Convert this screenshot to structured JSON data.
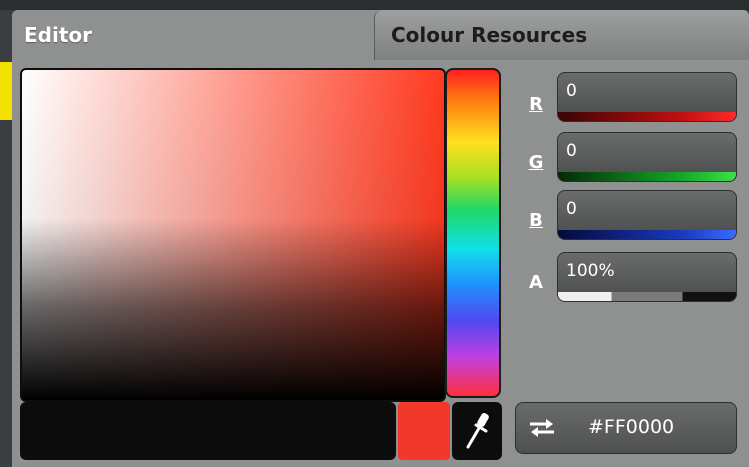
{
  "tabs": {
    "editor": "Editor",
    "resources": "Colour Resources"
  },
  "channels": {
    "r": {
      "label": "R",
      "value": "0"
    },
    "g": {
      "label": "G",
      "value": "0"
    },
    "b": {
      "label": "B",
      "value": "0"
    },
    "a": {
      "label": "A",
      "value": "100%"
    }
  },
  "hex_value": "#FF0000",
  "colors": {
    "current_swatch": "#f0392b",
    "hue_base": "#ff3a20"
  },
  "icons": {
    "eyedropper": "eyedropper-icon",
    "swap": "swap-arrows-icon"
  }
}
